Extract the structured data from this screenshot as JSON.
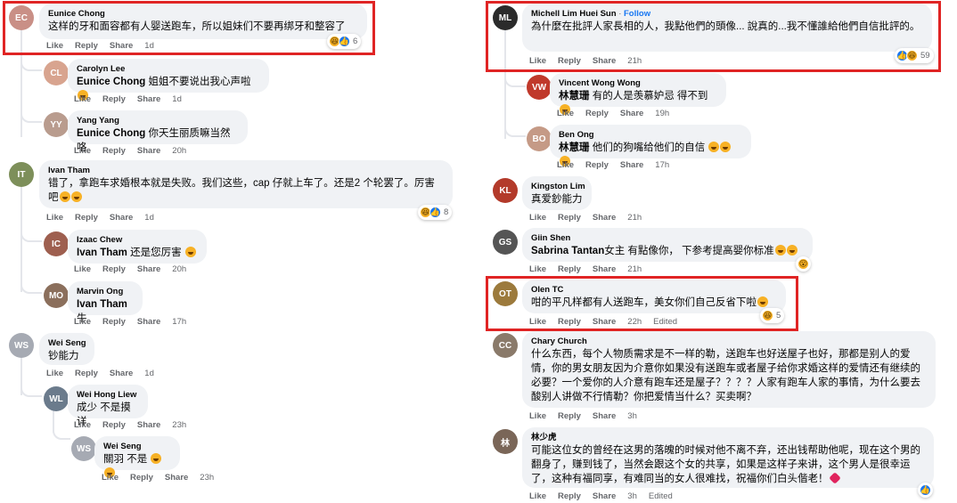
{
  "labels": {
    "like": "Like",
    "reply": "Reply",
    "share": "Share",
    "edited": "Edited",
    "follow": "Follow",
    "dot": "·"
  },
  "left": [
    {
      "author": "Eunice Chong",
      "text": "这样的牙和面容都有人婴送跑车，所以姐妹们不要再绑牙和整容了",
      "time": "1d",
      "reactions": "6"
    },
    {
      "author": "Carolyn Lee",
      "mention": "Eunice Chong",
      "text": "姐姐不要说出我心声啦",
      "time": "1d"
    },
    {
      "author": "Yang Yang",
      "mention": "Eunice Chong",
      "text": "你天生丽质嘛当然咯",
      "time": "20h"
    },
    {
      "author": "Ivan Tham",
      "text": "错了，拿跑车求婚根本就是失败。我们这些，cap 仔就上车了。还是2 个轮罢了。厉害吧",
      "time": "1d",
      "reactions": "8"
    },
    {
      "author": "Izaac Chew",
      "mention": "Ivan Tham",
      "text": "还是您厉害",
      "time": "20h"
    },
    {
      "author": "Marvin Ong",
      "mention": "Ivan Tham",
      "text": "牛",
      "time": "17h"
    },
    {
      "author": "Wei Seng",
      "text": "钞能力",
      "time": "1d"
    },
    {
      "author": "Wei Hong Liew",
      "text": "成少 不是摸详",
      "time": "23h"
    },
    {
      "author": "Wei Seng",
      "text": "關羽 不是",
      "time": "23h"
    }
  ],
  "right": [
    {
      "author": "Michell Lim Huei Sun",
      "text": "為什麼在批評人家長相的人，我點他們的頭像... 說真的...我不懂誰給他們自信批評的。",
      "time": "21h",
      "reactions": "59"
    },
    {
      "author": "Vincent Wong Wong",
      "mention": "林慧珊",
      "text": "有的人是羡慕妒忌 得不到",
      "time": "19h"
    },
    {
      "author": "Ben Ong",
      "mention": "林慧珊",
      "text": "他们的狗嘴给他们的自信",
      "time": "17h"
    },
    {
      "author": "Kingston Lim",
      "text": "真爱鈔能力",
      "time": "21h"
    },
    {
      "author": "Giin Shen",
      "mention": "Sabrina Tantan",
      "text": "女主 有點像你， 下参考提高婴你标准",
      "time": "21h"
    },
    {
      "author": "Olen TC",
      "text": "咁的平凡样都有人送跑车，美女你们自己反省下啦",
      "time": "22h",
      "reactions": "5"
    },
    {
      "author": "Chary Church",
      "text": "什么东西，每个人物质需求是不一样的勒，送跑车也好送屋子也好，那都是别人的爱情，你的男女朋友因为介意你如果没有送跑车或者屋子给你求婚这样的爱情还有继续的必要？一个爱你的人介意有跑车还是屋子？？？？人家有跑车人家的事情，为什么要去酸别人讲做不行情勒？你把爱情当什么？买卖啊？",
      "time": "3h"
    },
    {
      "author": "林少虎",
      "text": "可能这位女的曾经在这男的落魄的时候对他不离不弃，还出钱帮助他呢，现在这个男的翻身了，赚到钱了，当然会跟这个女的共享，如果是这样子来讲，这个男人是很幸运了，这种有福同享，有难同当的女人很难找，祝福你们白头偕老！",
      "time": "3h"
    }
  ],
  "colors": {
    "highlight": "#e02424",
    "bubble": "#f0f2f5",
    "meta": "#65676b",
    "link": "#1877f2"
  }
}
